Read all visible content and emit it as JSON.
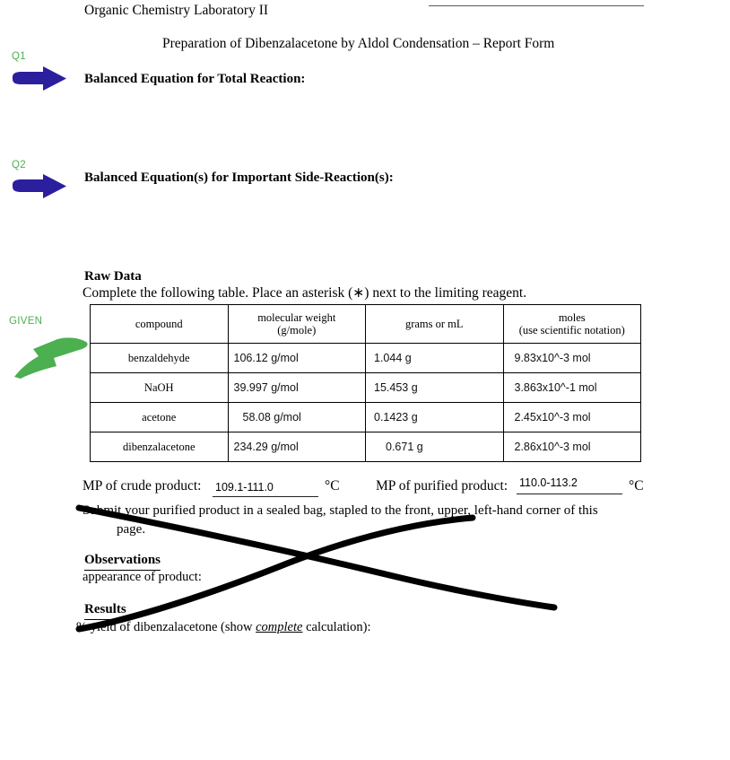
{
  "header": {
    "name_rule": "",
    "course_title": "Organic Chemistry Laboratory II",
    "report_title": "Preparation of Dibenzalacetone by Aldol Condensation – Report Form"
  },
  "annotations": [
    {
      "id": "q1",
      "label": "Q1",
      "color": "#2b1f9e",
      "label_color": "#4caf50"
    },
    {
      "id": "q2",
      "label": "Q2",
      "color": "#2b1f9e",
      "label_color": "#4caf50"
    },
    {
      "id": "given",
      "label": "GIVEN",
      "color": "#4caf50",
      "label_color": "#4caf50"
    }
  ],
  "sections": {
    "total_reaction_heading": "Balanced Equation for Total Reaction:",
    "side_reaction_heading": "Balanced Equation(s) for Important Side-Reaction(s):",
    "raw_data_heading": "Raw Data",
    "raw_data_instruction": "Complete the following table.  Place an asterisk (∗) next to the limiting reagent.",
    "observations_heading": "Observations",
    "observations_prompt": "appearance of product:",
    "results_heading": "Results",
    "results_prompt_pre": "% yield of dibenzalacetone (show ",
    "results_prompt_em": "complete",
    "results_prompt_post": " calculation):",
    "submit_note_line1": "Submit your purified product in a sealed bag, stapled to the front, upper, left-hand corner of this",
    "submit_note_line2": "page."
  },
  "table": {
    "columns": [
      {
        "key": "compound",
        "header": "compound",
        "sub": ""
      },
      {
        "key": "mw",
        "header": "molecular weight",
        "sub": "(g/mole)"
      },
      {
        "key": "mass",
        "header": "grams or mL",
        "sub": ""
      },
      {
        "key": "moles",
        "header": "moles",
        "sub": "(use scientific notation)"
      }
    ],
    "rows": [
      {
        "compound": "benzaldehyde",
        "mw": "106.12 g/mol",
        "mass": "1.044 g",
        "moles": "9.83x10^-3 mol"
      },
      {
        "compound": "NaOH",
        "mw": "39.997 g/mol",
        "mass": "15.453 g",
        "moles": "3.863x10^-1 mol"
      },
      {
        "compound": "acetone",
        "mw": "58.08 g/mol",
        "mass": "0.1423 g",
        "moles": "2.45x10^-3 mol"
      },
      {
        "compound": "dibenzalacetone",
        "mw": "234.29 g/mol",
        "mass": "0.671 g",
        "moles": "2.86x10^-3 mol"
      }
    ]
  },
  "melting_point": {
    "crude_label": "MP of crude product:",
    "crude_value": "109.1-111.0",
    "crude_unit": "°C",
    "purified_label": "MP of purified product:",
    "purified_value": "110.0-113.2",
    "purified_unit": "°C"
  },
  "markup": {
    "stroke_color": "#000000",
    "strokes": [
      "M 88 566 C 200 588, 330 616, 430 640 C 500 657, 570 670, 618 677",
      "M 88 701 C 150 690, 240 660, 320 628 C 400 597, 470 582, 527 577"
    ]
  }
}
